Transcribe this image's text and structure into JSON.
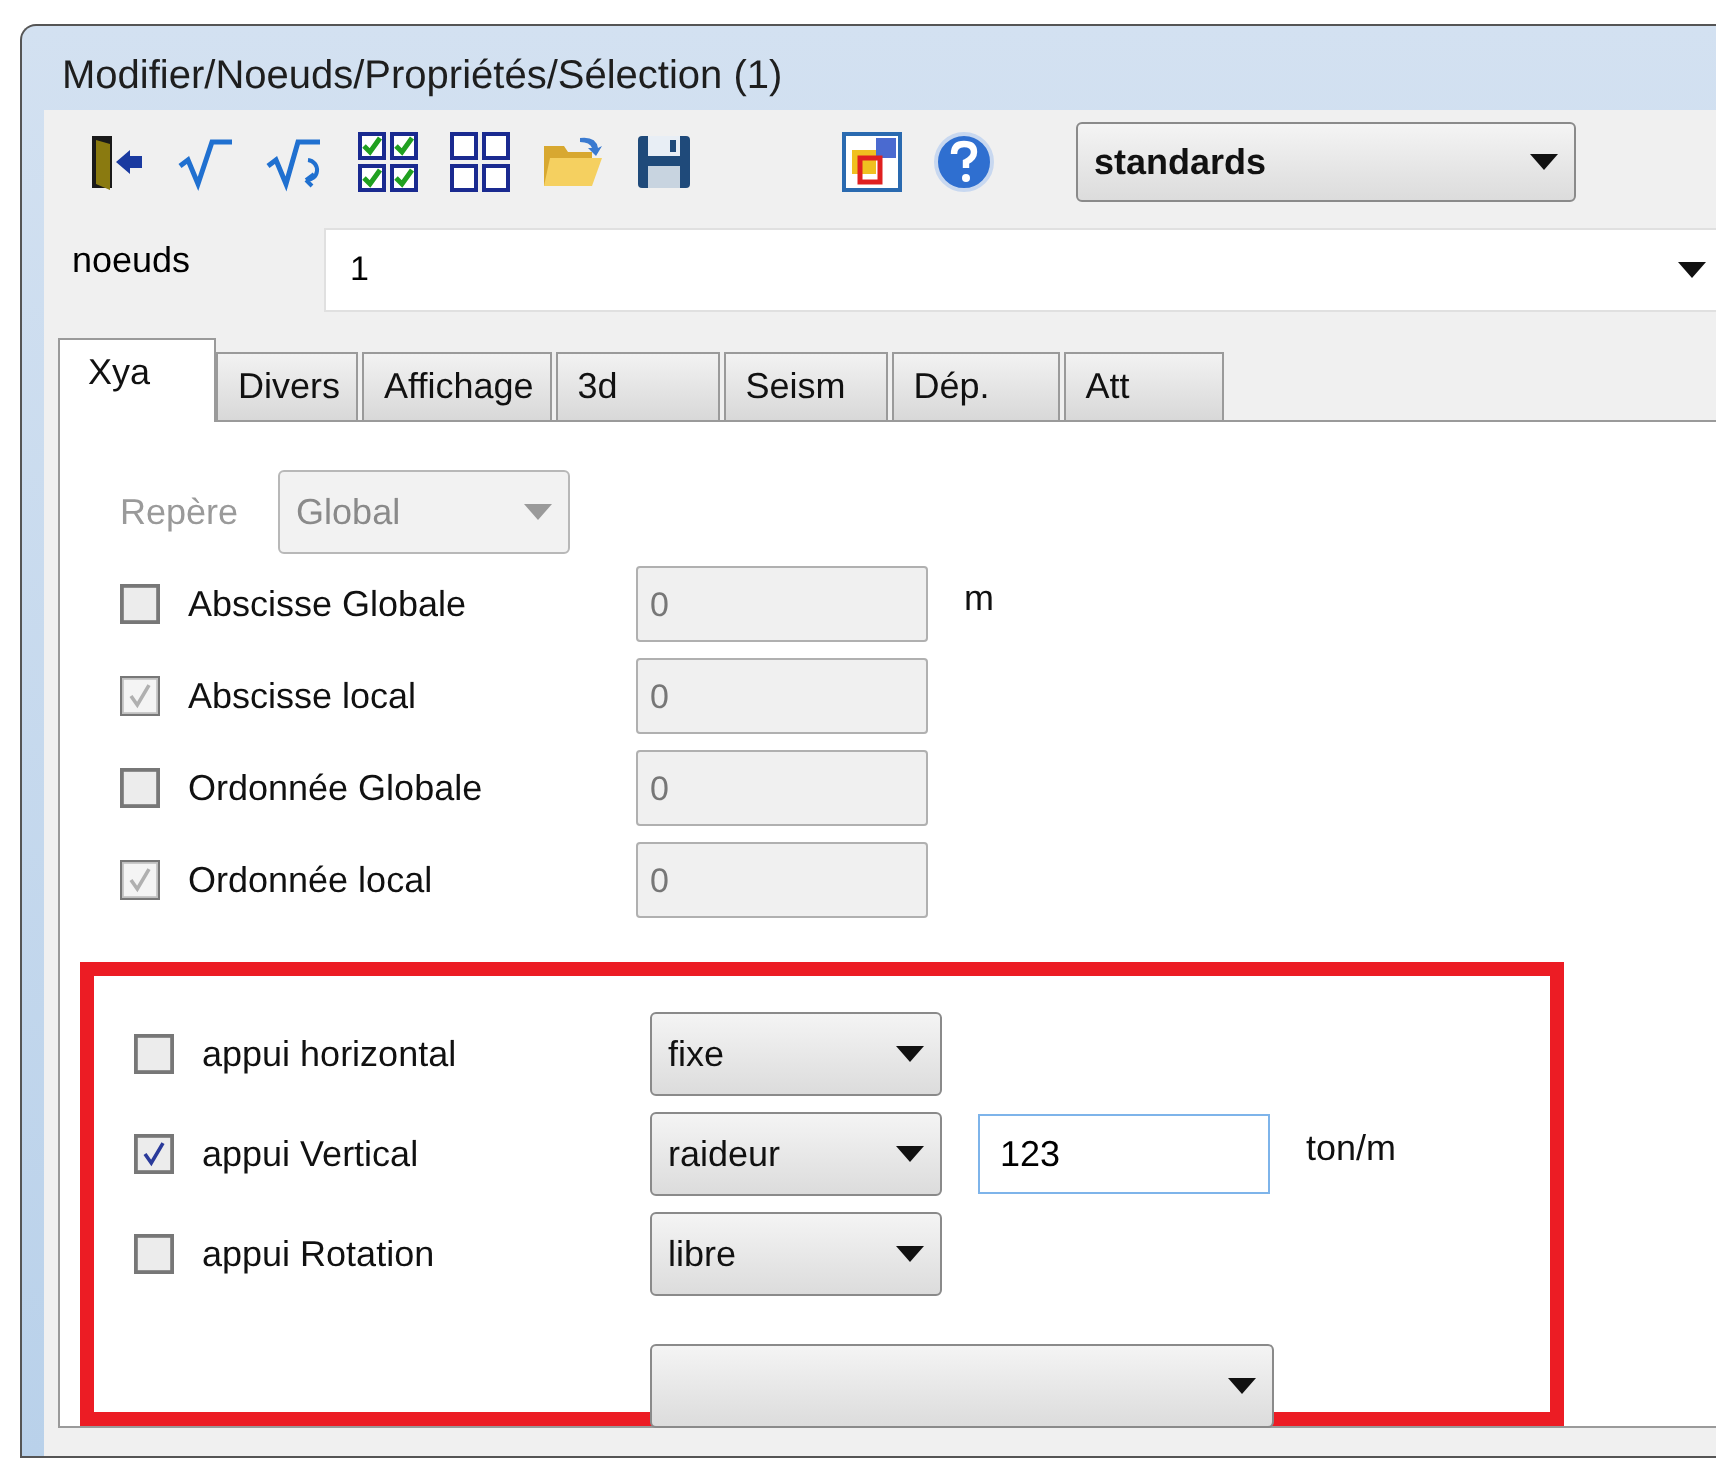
{
  "window": {
    "title": "Modifier/Noeuds/Propriétés/Sélection (1)"
  },
  "toolbar": {
    "preset": "standards"
  },
  "selector": {
    "label": "noeuds",
    "value": "1"
  },
  "tabs": [
    {
      "label": "Xya",
      "selected": true
    },
    {
      "label": "Divers",
      "selected": false
    },
    {
      "label": "Affichage",
      "selected": false
    },
    {
      "label": "3d",
      "selected": false
    },
    {
      "label": "Seism",
      "selected": false
    },
    {
      "label": "Dép.",
      "selected": false
    },
    {
      "label": "Att",
      "selected": false
    }
  ],
  "reference": {
    "label": "Repère",
    "value": "Global",
    "disabled": true
  },
  "coordinates": [
    {
      "label": "Abscisse Globale",
      "checked": false,
      "disabled": false,
      "value": "0",
      "unit": "m"
    },
    {
      "label": "Abscisse local",
      "checked": true,
      "disabled": true,
      "value": "0"
    },
    {
      "label": "Ordonnée Globale",
      "checked": false,
      "disabled": false,
      "value": "0"
    },
    {
      "label": "Ordonnée local",
      "checked": true,
      "disabled": true,
      "value": "0"
    }
  ],
  "supports": [
    {
      "kind": "support",
      "label": "appui horizontal",
      "checked": false,
      "mode": "fixe"
    },
    {
      "kind": "support",
      "label": "appui Vertical",
      "checked": true,
      "mode": "raideur",
      "value": "123",
      "unit": "ton/m"
    },
    {
      "kind": "support",
      "label": "appui Rotation",
      "checked": false,
      "mode": "libre"
    },
    {
      "kind": "dropdown"
    }
  ]
}
